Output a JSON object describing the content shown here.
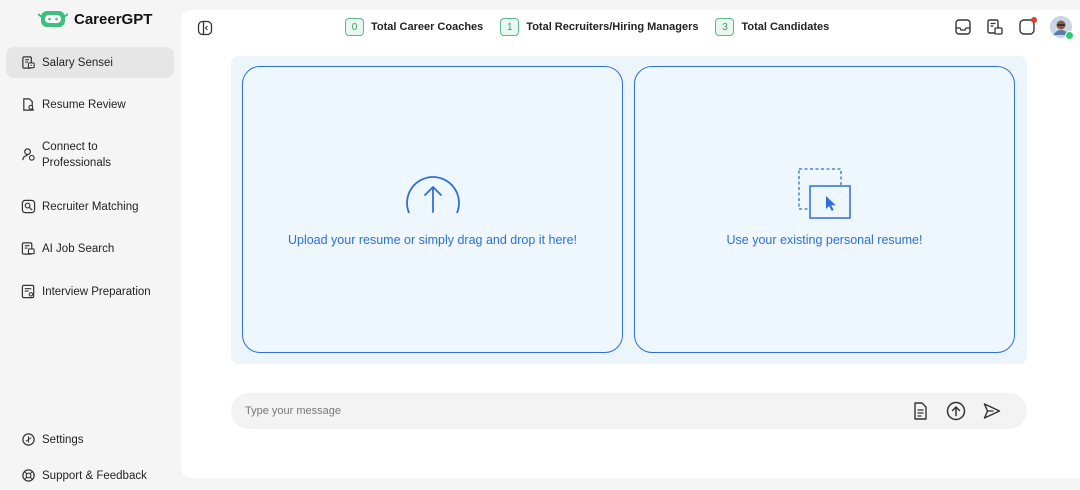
{
  "app": {
    "name": "CareerGPT"
  },
  "sidebar": {
    "items": [
      {
        "label": "Salary Sensei",
        "icon": "salary-icon",
        "active": true
      },
      {
        "label": "Resume Review",
        "icon": "resume-review-icon"
      },
      {
        "label": "Connect to",
        "label2": "Professionals",
        "icon": "professionals-icon"
      },
      {
        "label": "Recruiter Matching",
        "icon": "recruiter-matching-icon"
      },
      {
        "label": "AI Job Search",
        "icon": "job-search-icon"
      },
      {
        "label": "Interview Preparation",
        "icon": "interview-icon"
      }
    ],
    "footer": [
      {
        "label": "Settings",
        "icon": "settings-icon"
      },
      {
        "label": "Support & Feedback",
        "icon": "support-icon"
      }
    ]
  },
  "header": {
    "stats": [
      {
        "count": "0",
        "label": "Total Career Coaches"
      },
      {
        "count": "1",
        "label": "Total Recruiters/Hiring Managers"
      },
      {
        "count": "3",
        "label": "Total Candidates"
      }
    ]
  },
  "upload": {
    "upload_text": "Upload your resume or simply drag and drop it here!",
    "existing_text": "Use your existing personal resume!"
  },
  "composer": {
    "placeholder": "Type your message"
  },
  "colors": {
    "accent": "#2f6fd8",
    "badge": "#5cb88d",
    "notification": "#e53935",
    "online": "#2ecc71"
  }
}
